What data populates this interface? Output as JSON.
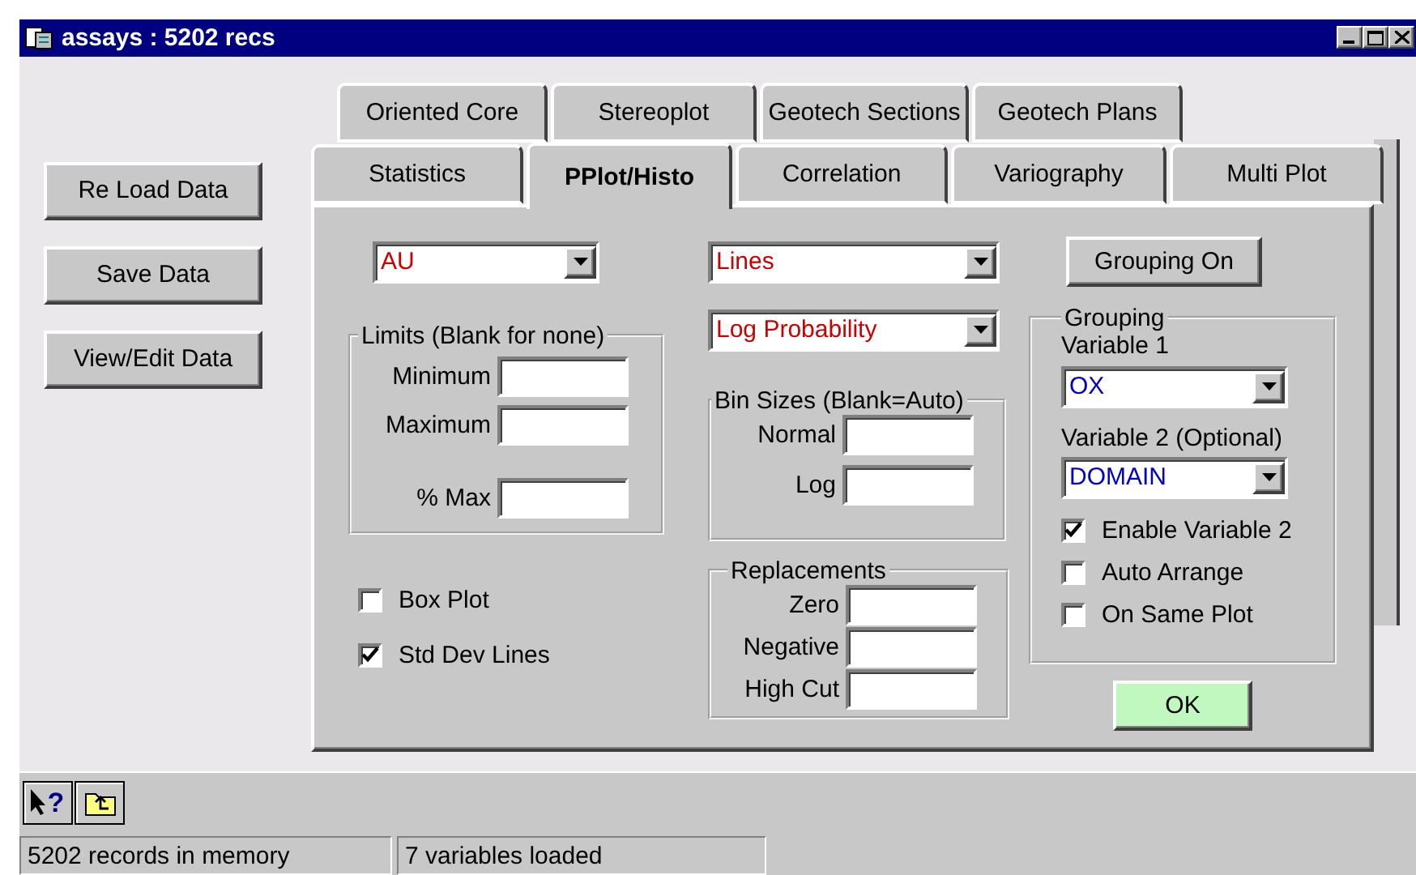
{
  "window": {
    "title": "assays : 5202 recs"
  },
  "side_buttons": [
    {
      "label": "Re Load Data"
    },
    {
      "label": "Save Data"
    },
    {
      "label": "View/Edit Data"
    }
  ],
  "tab_rows": [
    {
      "tabs": [
        {
          "label": "Oriented Core",
          "selected": false
        },
        {
          "label": "Stereoplot",
          "selected": false
        },
        {
          "label": "Geotech Sections",
          "selected": false
        },
        {
          "label": "Geotech Plans",
          "selected": false
        }
      ]
    },
    {
      "tabs": [
        {
          "label": "Statistics",
          "selected": false
        },
        {
          "label": "PPlot/Histo",
          "selected": true
        },
        {
          "label": "Correlation",
          "selected": false
        },
        {
          "label": "Variography",
          "selected": false
        },
        {
          "label": "Multi Plot",
          "selected": false
        }
      ]
    }
  ],
  "panel": {
    "variable_select": {
      "value": "AU",
      "color": "#cc0000"
    },
    "limits": {
      "title": "Limits (Blank for none)",
      "fields": [
        {
          "label": "Minimum"
        },
        {
          "label": "Maximum"
        },
        {
          "label": "% Max"
        }
      ]
    },
    "options": [
      {
        "label": "Box Plot",
        "checked": false
      },
      {
        "label": "Std Dev Lines",
        "checked": true
      }
    ],
    "line_select": {
      "value": "Lines",
      "color": "#cc0000"
    },
    "plot_type_select": {
      "value": "Log Probability",
      "color": "#cc0000"
    },
    "bin_sizes": {
      "title": "Bin Sizes (Blank=Auto)",
      "fields": [
        {
          "label": "Normal"
        },
        {
          "label": "Log"
        }
      ]
    },
    "replacements": {
      "title": "Replacements",
      "fields": [
        {
          "label": "Zero"
        },
        {
          "label": "Negative"
        },
        {
          "label": "High Cut"
        }
      ]
    },
    "grouping_button": {
      "label": "Grouping On"
    },
    "grouping": {
      "title": "Grouping",
      "variable1_label": "Variable 1",
      "variable1": {
        "value": "OX",
        "color": "#0000cc"
      },
      "variable2_label": "Variable 2 (Optional)",
      "variable2": {
        "value": "DOMAIN",
        "color": "#0000cc"
      },
      "options": [
        {
          "label": "Enable Variable 2",
          "checked": true
        },
        {
          "label": "Auto Arrange",
          "checked": false
        },
        {
          "label": "On Same Plot",
          "checked": false
        }
      ]
    },
    "ok_button": {
      "label": "OK"
    }
  },
  "toolbar": [
    {
      "kind": "help",
      "symbol": "?"
    },
    {
      "kind": "up_folder"
    }
  ],
  "status_bar": [
    "5202 records in memory",
    "7 variables loaded"
  ]
}
